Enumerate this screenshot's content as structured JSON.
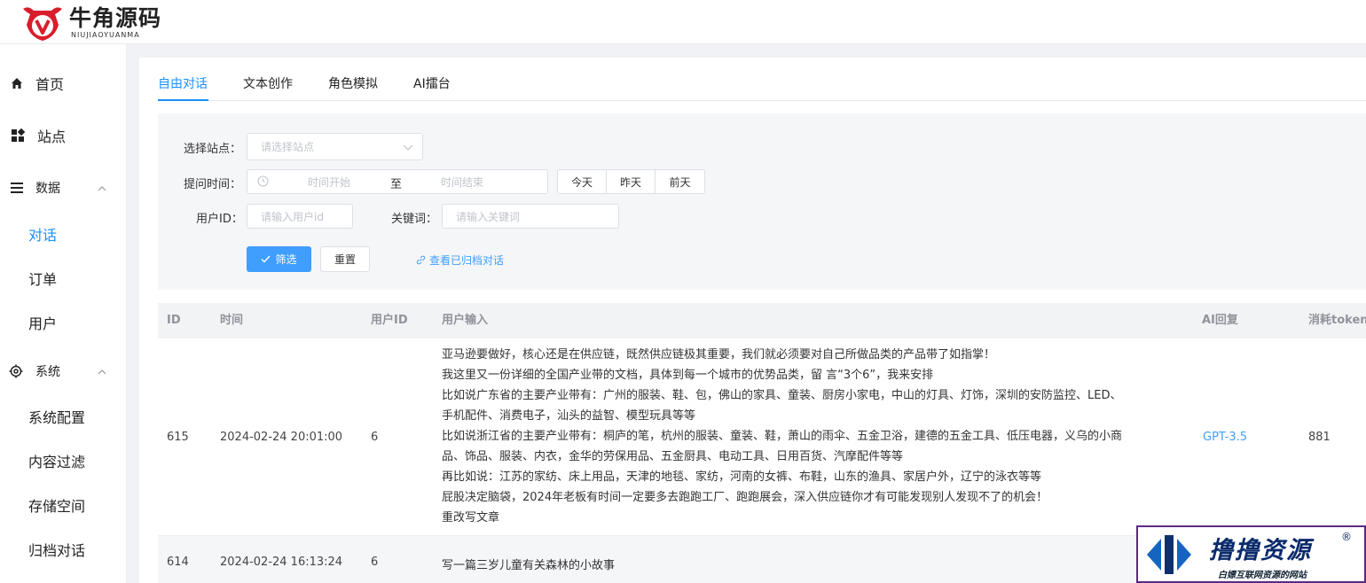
{
  "header": {
    "logo_cn": "牛角源码",
    "logo_en": "NIUJIAOYUANMA"
  },
  "sidebar": {
    "items": [
      {
        "label": "首页",
        "icon": "home-icon"
      },
      {
        "label": "站点",
        "icon": "grid-icon"
      },
      {
        "label": "数据",
        "icon": "menu-lines-icon",
        "expanded": true
      },
      {
        "label": "系统",
        "icon": "gear-icon",
        "expanded": true
      }
    ],
    "data_children": [
      "对话",
      "订单",
      "用户"
    ],
    "system_children": [
      "系统配置",
      "内容过滤",
      "存储空间",
      "归档对话"
    ],
    "active": "对话"
  },
  "tabs": [
    "自由对话",
    "文本创作",
    "角色模拟",
    "AI擂台"
  ],
  "filter": {
    "site_label": "选择站点：",
    "site_placeholder": "请选择站点",
    "time_label": "提问时间：",
    "time_start": "时间开始",
    "time_sep": "至",
    "time_end": "时间结束",
    "quick_days": [
      "今天",
      "昨天",
      "前天"
    ],
    "user_label": "用户ID：",
    "user_placeholder": "请输入用户id",
    "keyword_label": "关键词：",
    "keyword_placeholder": "请输入关键词",
    "filter_button": "筛选",
    "reset_button": "重置",
    "archive_link": "查看已归档对话"
  },
  "table": {
    "columns": [
      "ID",
      "时间",
      "用户ID",
      "用户输入",
      "AI回复",
      "消耗token"
    ],
    "rows": [
      {
        "id": "615",
        "time": "2024-02-24 20:01:00",
        "user_id": "6",
        "input_lines": [
          "亚马逊要做好，核心还是在供应链，既然供应链极其重要，我们就必须要对自己所做品类的产品带了如指掌！",
          "我这里又一份详细的全国产业带的文档，具体到每一个城市的优势品类，留 言“3个6”，我来安排",
          "比如说广东省的主要产业带有：广州的服装、鞋、包，佛山的家具、童装、厨房小家电，中山的灯具、灯饰，深圳的安防监控、LED、",
          "手机配件、消费电子，汕头的益智、模型玩具等等",
          "比如说浙江省的主要产业带有：桐庐的笔，杭州的服装、童装、鞋，萧山的雨伞、五金卫浴，建德的五金工具、低压电器，义乌的小商",
          "品、饰品、服装、内衣，金华的劳保用品、五金厨具、电动工具、日用百货、汽摩配件等等",
          "再比如说：江苏的家纺、床上用品，天津的地毯、家纺，河南的女裤、布鞋，山东的渔具、家居户外，辽宁的泳衣等等",
          "屁股决定脑袋，2024年老板有时间一定要多去跑跑工厂、跑跑展会，深入供应链你才有可能发现别人发现不了的机会！",
          "重改写文章"
        ],
        "ai": "GPT-3.5",
        "tokens": "881"
      },
      {
        "id": "614",
        "time": "2024-02-24 16:13:24",
        "user_id": "6",
        "input_lines": [
          "写一篇三岁儿童有关森林的小故事"
        ],
        "ai": "",
        "tokens": ""
      }
    ]
  },
  "watermark": {
    "main": "撸撸资源",
    "sub": "白嫖互联网资源的网站",
    "reg": "®"
  },
  "colors": {
    "accent": "#1890ff",
    "primary_button": "#409eff",
    "brand_red": "#d81e2c"
  }
}
